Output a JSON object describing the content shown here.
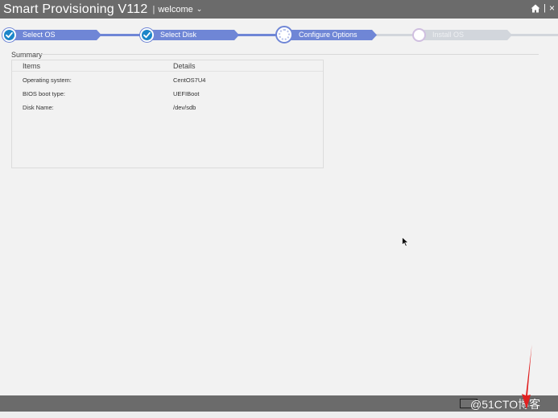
{
  "header": {
    "app_title": "Smart Provisioning V112",
    "separator": "|",
    "welcome": "welcome",
    "right_separator": "|",
    "close": "×"
  },
  "steps": [
    {
      "label": "Select OS",
      "status": "done"
    },
    {
      "label": "Select Disk",
      "status": "done"
    },
    {
      "label": "Configure Options",
      "status": "active"
    },
    {
      "label": "Install OS",
      "status": "todo"
    }
  ],
  "summary": {
    "title": "Summary",
    "columns": [
      "Items",
      "Details"
    ],
    "rows": [
      {
        "item": "Operating system:",
        "detail": "CentOS7U4"
      },
      {
        "item": "BIOS boot type:",
        "detail": "UEFIBoot"
      },
      {
        "item": "Disk Name:",
        "detail": "/dev/sdb"
      }
    ]
  },
  "watermark": "@51CTO博客",
  "colors": {
    "titlebar": "#6b6b6b",
    "step_active": "#6f86d6",
    "step_done_icon": "#1c86c9",
    "step_todo": "#d2d6dc",
    "background": "#f2f2f2",
    "annotation_arrow": "#e02020"
  },
  "icons": {
    "home": "home-icon",
    "dropdown": "chevron-down-icon",
    "check": "check-icon",
    "cursor": "mouse-pointer-icon"
  }
}
